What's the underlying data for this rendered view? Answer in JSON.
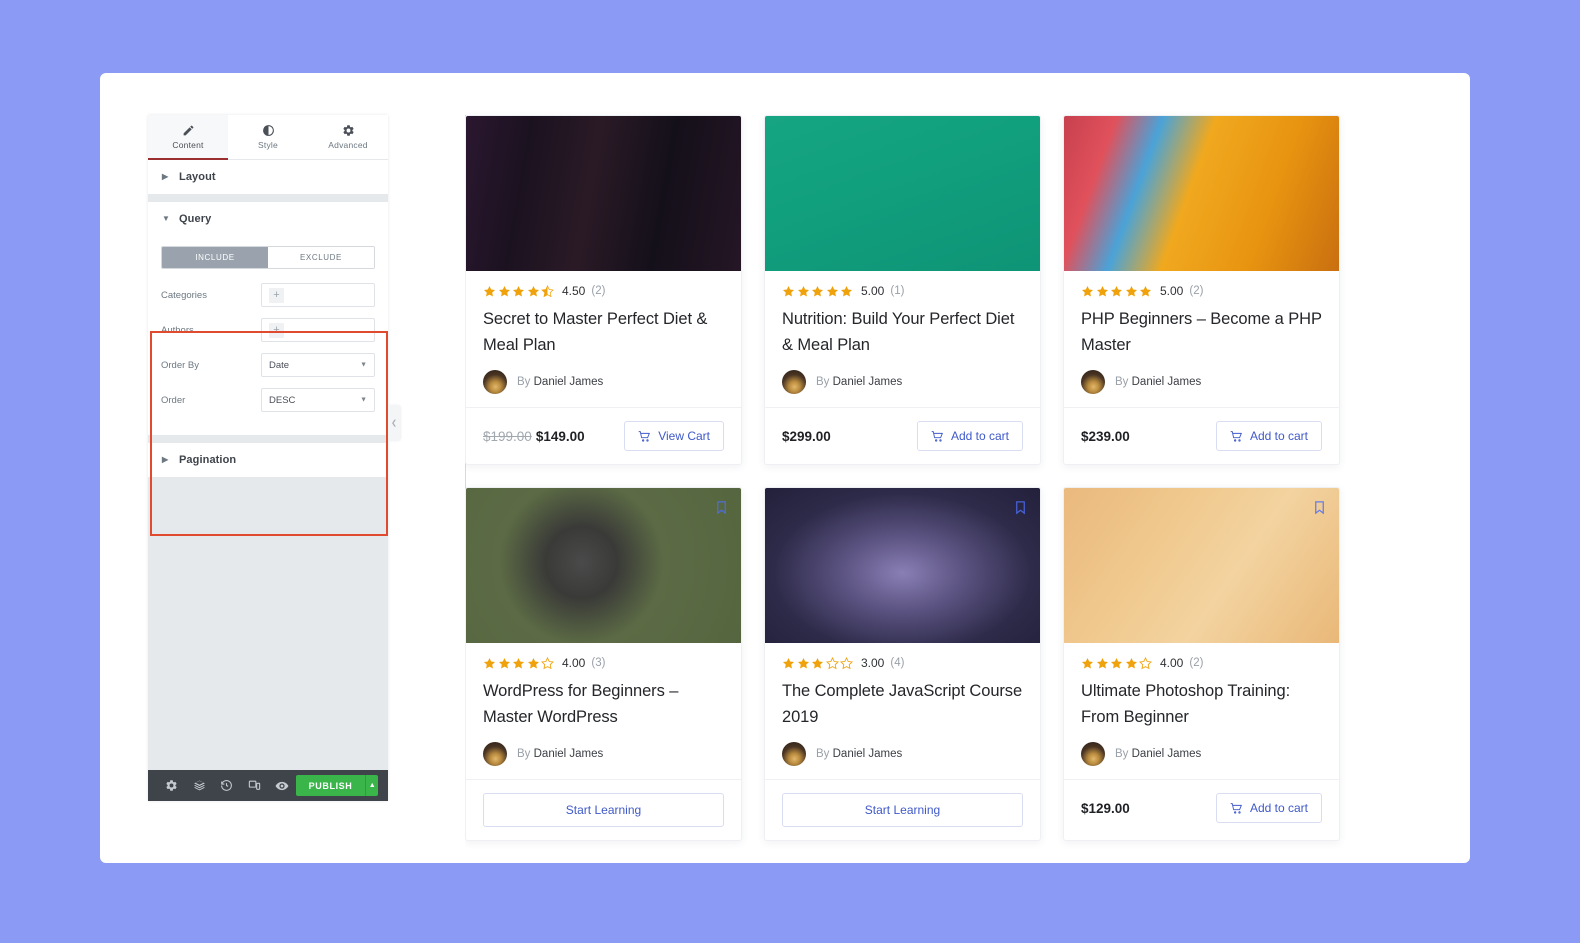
{
  "colors": {
    "page_background": "#8b9bf5",
    "accent_red_highlight": "#e04a2f",
    "publish_green": "#39b54a",
    "star_orange": "#f0a20c",
    "link_blue": "#3f59c9"
  },
  "panel": {
    "tabs": [
      {
        "label": "Content",
        "icon": "pencil-icon",
        "active": true
      },
      {
        "label": "Style",
        "icon": "contrast-icon",
        "active": false
      },
      {
        "label": "Advanced",
        "icon": "gear-icon",
        "active": false
      }
    ],
    "sections": {
      "layout": {
        "label": "Layout",
        "expanded": false
      },
      "query": {
        "label": "Query",
        "expanded": true
      },
      "pagination": {
        "label": "Pagination",
        "expanded": false
      }
    },
    "query": {
      "include_label": "INCLUDE",
      "exclude_label": "EXCLUDE",
      "active_toggle": "INCLUDE",
      "fields": [
        {
          "label": "Categories",
          "type": "chips",
          "value": "",
          "add_icon": "plus-icon"
        },
        {
          "label": "Authors",
          "type": "chips",
          "value": "",
          "add_icon": "plus-icon"
        },
        {
          "label": "Order By",
          "type": "select",
          "value": "Date",
          "caret": "chevron-down-icon"
        },
        {
          "label": "Order",
          "type": "select",
          "value": "DESC",
          "caret": "chevron-down-icon"
        }
      ]
    },
    "footer": {
      "icons": [
        "settings-gear-icon",
        "navigator-layers-icon",
        "history-revisions-icon",
        "responsive-preview-icon",
        "preview-eye-icon"
      ],
      "publish_label": "PUBLISH",
      "publish_caret": "chevron-up-icon"
    },
    "collapse_handle_icon": "chevron-left-icon"
  },
  "grid": {
    "labels": {
      "by_prefix": "By",
      "bookmark_icon": "bookmark-icon",
      "cart_icon": "shopping-cart-icon"
    },
    "cards": [
      {
        "image_name": "studio-desk-dark-photo",
        "image_css": "linear-gradient(100deg,#2b1730 0%,#1b1220 22%,#2a1a26 45%,#14101a 70%,#251625 100%)",
        "has_bookmark": false,
        "rating": "4.50",
        "rating_stars": 4.5,
        "review_count": "(2)",
        "title": "Secret to Master Perfect Diet & Meal Plan",
        "author": "Daniel James",
        "price": "$149.00",
        "old_price": "$199.00",
        "action_label": "View Cart",
        "action_style": "inline"
      },
      {
        "image_name": "green-drinking-glass-photo",
        "image_css": "linear-gradient(160deg,#16a583 0%,#11a07e 40%,#0e9476 100%)",
        "has_bookmark": false,
        "rating": "5.00",
        "rating_stars": 5,
        "review_count": "(1)",
        "title": "Nutrition: Build Your Perfect Diet & Meal Plan",
        "author": "Daniel James",
        "price": "$299.00",
        "old_price": "",
        "action_label": "Add to cart",
        "action_style": "inline"
      },
      {
        "image_name": "colorful-abstract-shapes-photo",
        "image_css": "linear-gradient(110deg,#c8404e 0%,#e0515c 16%,#4aa3d8 30%,#f0a81f 46%,#e89410 72%,#c96f10 100%)",
        "has_bookmark": false,
        "rating": "5.00",
        "rating_stars": 5,
        "review_count": "(2)",
        "title": "PHP Beginners – Become a PHP Master",
        "author": "Daniel James",
        "price": "$239.00",
        "old_price": "",
        "action_label": "Add to cart",
        "action_style": "inline"
      },
      {
        "image_name": "vintage-camera-on-green-photo",
        "image_css": "radial-gradient(circle at 42% 48%, #4a4a4a 0%, #3a3a38 20%, #5c6b45 46%, #55663f 100%)",
        "has_bookmark": true,
        "rating": "4.00",
        "rating_stars": 4,
        "review_count": "(3)",
        "title": "WordPress for Beginners – Master WordPress",
        "author": "Daniel James",
        "price": "",
        "old_price": "",
        "action_label": "Start Learning",
        "action_style": "wide"
      },
      {
        "image_name": "electric-guitar-spotlight-photo",
        "image_css": "radial-gradient(ellipse at 50% 55%, #8a7fb5 0%, #5a5280 32%, #2e2b4a 66%, #22203a 100%)",
        "has_bookmark": true,
        "rating": "3.00",
        "rating_stars": 3,
        "review_count": "(4)",
        "title": "The Complete JavaScript Course 2019",
        "author": "Daniel James",
        "price": "",
        "old_price": "",
        "action_label": "Start Learning",
        "action_style": "wide"
      },
      {
        "image_name": "phone-payment-app-photo",
        "image_css": "linear-gradient(125deg,#eab97e 0%,#f0c98e 35%,#f3d3a0 60%,#e9b878 100%)",
        "has_bookmark": true,
        "rating": "4.00",
        "rating_stars": 4,
        "review_count": "(2)",
        "title": "Ultimate Photoshop Training: From Beginner",
        "author": "Daniel James",
        "price": "$129.00",
        "old_price": "",
        "action_label": "Add to cart",
        "action_style": "inline"
      }
    ]
  }
}
